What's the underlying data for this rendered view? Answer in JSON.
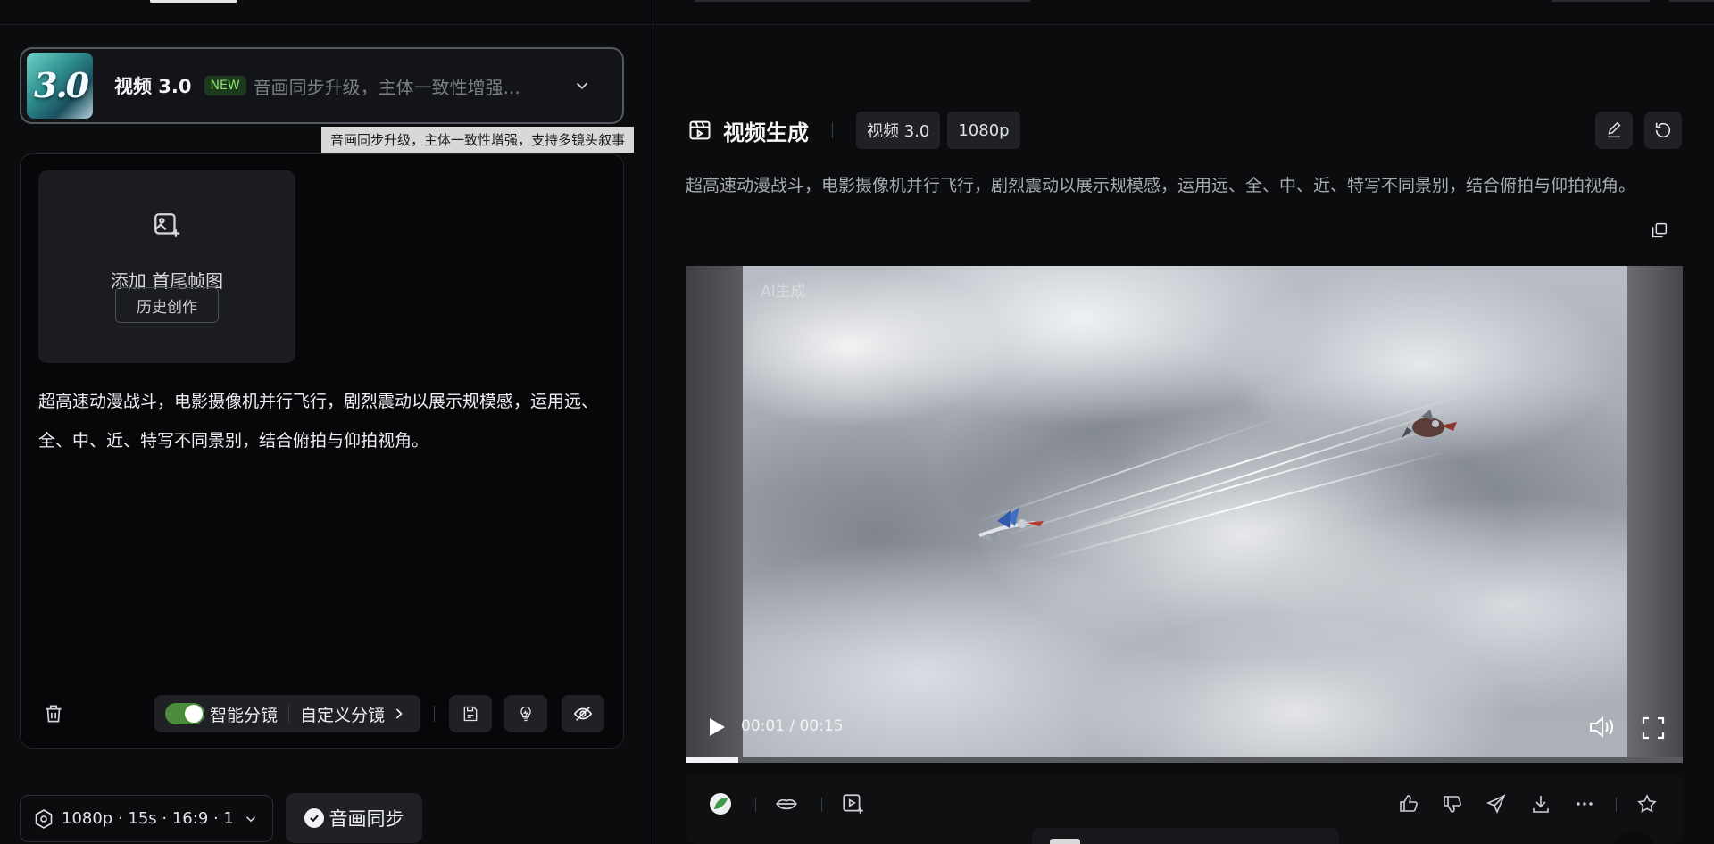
{
  "model": {
    "logo_text": "3.0",
    "name": "视频 3.0",
    "badge": "NEW",
    "description": "音画同步升级，主体一致性增强...",
    "tooltip": "音画同步升级，主体一致性增强，支持多镜头叙事"
  },
  "prompt_card": {
    "add_frames_label": "添加 首尾帧图",
    "history_label": "历史创作",
    "prompt": "超高速动漫战斗，电影摄像机并行飞行，剧烈震动以展示规模感，运用远、全、中、近、特写不同景别，结合俯拍与仰拍视角。",
    "smart_storyboard_label": "智能分镜",
    "smart_storyboard_on": true,
    "custom_storyboard_label": "自定义分镜"
  },
  "settings": {
    "summary": "1080p · 15s · 16:9 · 1",
    "audio_sync_label": "音画同步"
  },
  "result": {
    "title": "视频生成",
    "tags": [
      "视频 3.0",
      "1080p"
    ],
    "prompt": "超高速动漫战斗，电影摄像机并行飞行，剧烈震动以展示规模感，运用远、全、中、近、特写不同景别，结合俯拍与仰拍视角。",
    "video": {
      "watermark": "AI生成",
      "current_time": "00:01",
      "separator": "/",
      "duration": "00:15",
      "progress": 0.053
    }
  },
  "colors": {
    "accent_green": "#4b8b3b",
    "badge_green": "#8fe36a",
    "panel": "#1f2125",
    "background": "#0b0c0e"
  },
  "icons": {
    "frame_add": "image-plus-icon",
    "trash": "trash-icon",
    "save": "save-icon",
    "inspire": "lightbulb-icon",
    "no_watermark": "eye-off-icon",
    "settings": "hexagon-settings-icon",
    "check": "check-circle-icon",
    "generate": "clapperboard-icon",
    "edit": "pencil-icon",
    "regenerate": "refresh-icon",
    "copy": "copy-icon",
    "play": "play-icon",
    "volume": "volume-icon",
    "fullscreen": "fullscreen-icon",
    "like": "thumbs-up-icon",
    "dislike": "thumbs-down-icon",
    "share": "send-icon",
    "download": "download-icon",
    "more": "more-icon",
    "favorite": "star-icon"
  }
}
